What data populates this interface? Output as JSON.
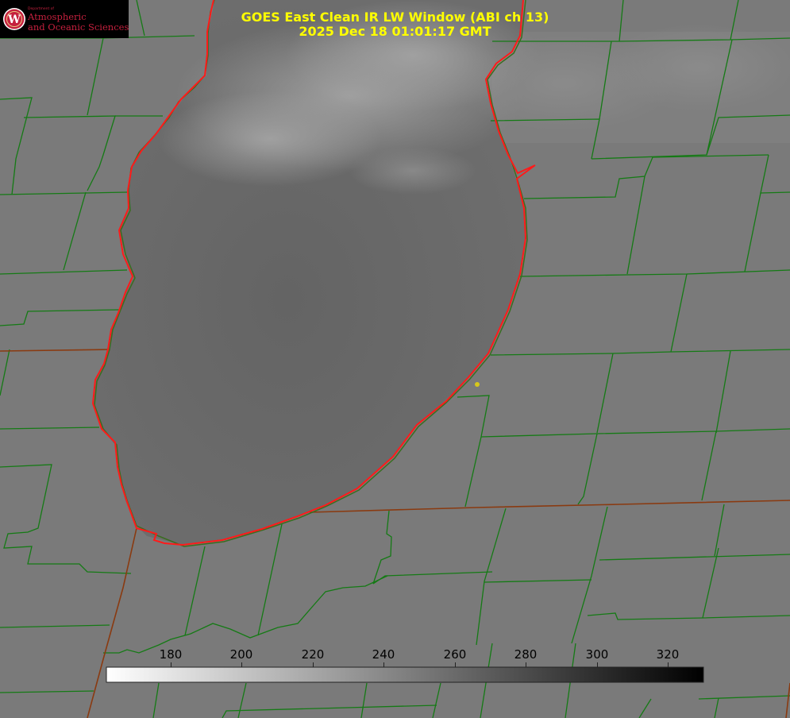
{
  "logo": {
    "department": "Department of",
    "line1": "Atmospheric",
    "line2": "and Oceanic Sciences",
    "seal_letter": "W",
    "icon": "uw-crest-icon"
  },
  "title": {
    "line1": "GOES East Clean IR LW Window (ABI ch 13)",
    "line2": "2025 Dec 18 01:01:17 GMT"
  },
  "colorbar": {
    "ticks": [
      180,
      200,
      220,
      240,
      260,
      280,
      300,
      320
    ],
    "range": [
      162,
      330
    ],
    "gradient": "white-to-black"
  },
  "colors": {
    "title": "#ffff00",
    "county_borders": "#157a15",
    "state_borders": "#8a3a10",
    "coastline": "#ff1a1a",
    "marker": "#d7c81a",
    "land": "#7b7b7b",
    "lake": "#6a6a6a",
    "cloud": "#9a9a9a"
  }
}
